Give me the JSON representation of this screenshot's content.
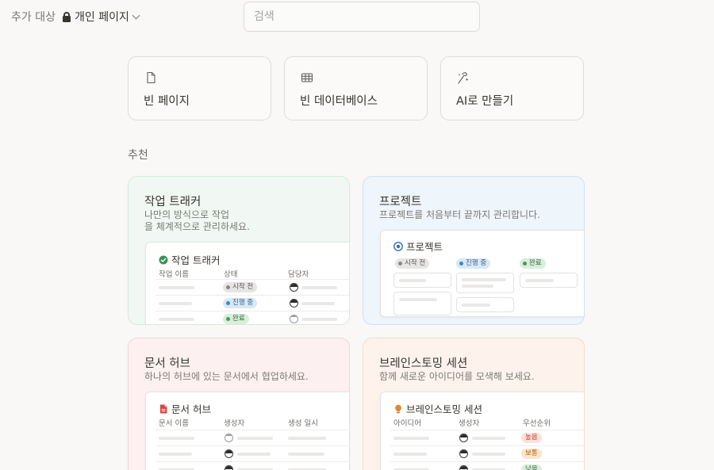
{
  "topbar": {
    "add_to_label": "추가 대상",
    "page_name": "개인 페이지",
    "search_placeholder": "검색"
  },
  "quick_actions": [
    {
      "label": "빈 페이지",
      "icon": "page-icon"
    },
    {
      "label": "빈 데이터베이스",
      "icon": "table-icon"
    },
    {
      "label": "AI로 만들기",
      "icon": "ai-wand-icon"
    }
  ],
  "section_label": "추천",
  "templates": {
    "task_tracker": {
      "title": "작업 트래커",
      "desc_line1": "나만의 방식으로 작업",
      "desc_line2": "을 체계적으로 관리하세요.",
      "preview_title": "작업 트래커",
      "columns": [
        "작업 이름",
        "상태",
        "담당자"
      ],
      "statuses": [
        "시작 전",
        "진행 중",
        "완료"
      ],
      "colors": {
        "bg": "#f1f8f3",
        "border": "#d5e9da",
        "icon": "#3e8e55"
      }
    },
    "project": {
      "title": "프로젝트",
      "desc": "프로젝트를 처음부터 끝까지 관리합니다.",
      "preview_title": "프로젝트",
      "groups": [
        "시작 전",
        "진행 중",
        "완료"
      ],
      "colors": {
        "bg": "#eef5fb",
        "border": "#cfe1f1",
        "icon": "#2f6fb0"
      }
    },
    "doc_hub": {
      "title": "문서 허브",
      "desc": "하나의 허브에 있는 문서에서 협업하세요.",
      "preview_title": "문서 허브",
      "columns": [
        "문서 이름",
        "생성자",
        "생성 일시"
      ],
      "colors": {
        "bg": "#fcf1f0",
        "border": "#f3d6d3",
        "icon": "#d4473a"
      }
    },
    "brainstorm": {
      "title": "브레인스토밍 세션",
      "desc": "함께 새로운 아이디어를 모색해 보세요.",
      "preview_title": "브레인스토밍 세션",
      "columns": [
        "아이디어",
        "생성자",
        "우선순위"
      ],
      "priorities": [
        "높음",
        "보통",
        "낮음"
      ],
      "colors": {
        "bg": "#fdf3ec",
        "border": "#f5dccb",
        "icon": "#e08a2c"
      }
    }
  }
}
